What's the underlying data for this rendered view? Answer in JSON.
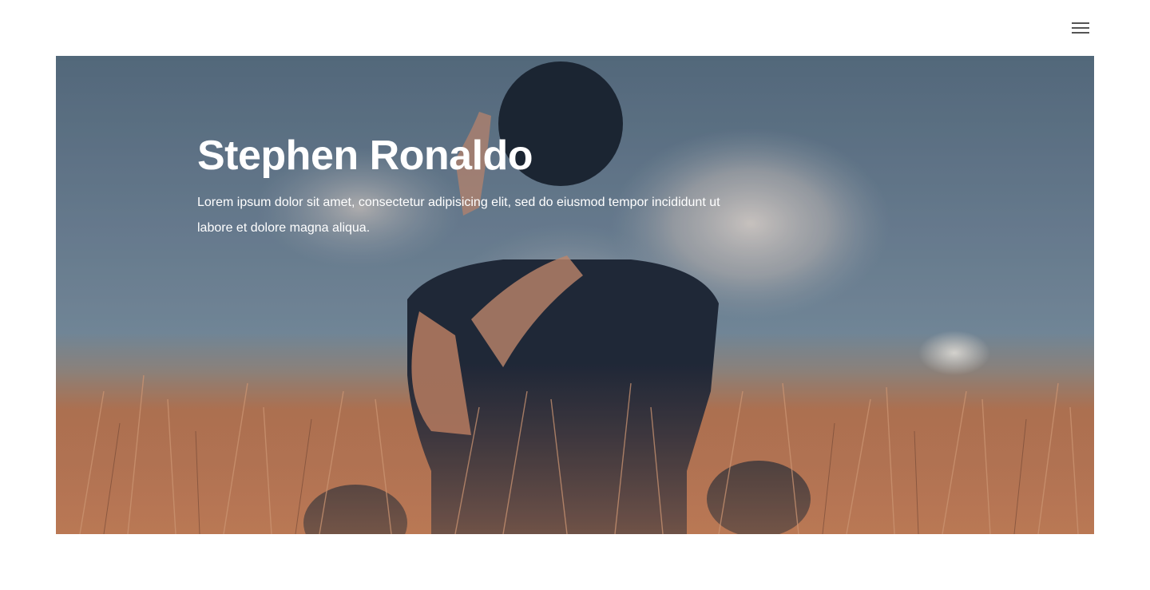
{
  "header": {
    "menu_icon": "hamburger-menu-icon"
  },
  "hero": {
    "title": "Stephen Ronaldo",
    "description": "Lorem ipsum dolor sit amet, consectetur adipisicing elit, sed do eiusmod tempor incididunt ut labore et dolore magna aliqua.",
    "image": "person-throwing-sand-in-wheat-field"
  },
  "colors": {
    "background": "#ffffff",
    "menu_icon": "#555555",
    "hero_text": "#ffffff",
    "sky": "#6f8497",
    "field": "#c97c55"
  }
}
